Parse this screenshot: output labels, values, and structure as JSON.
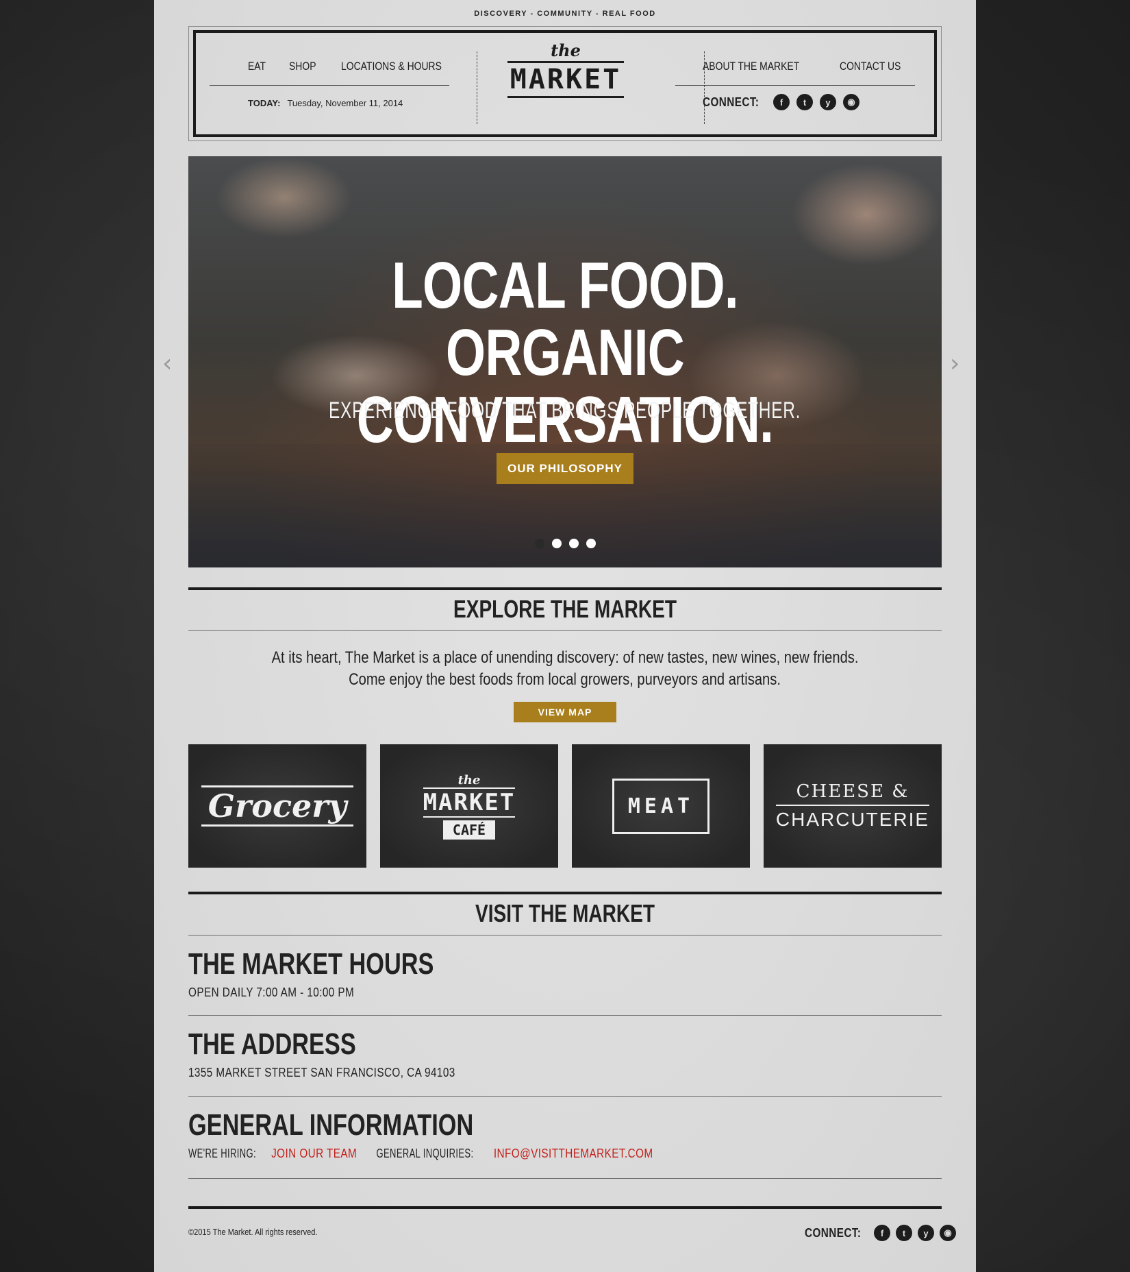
{
  "tagline": "DISCOVERY - COMMUNITY - REAL FOOD",
  "nav": {
    "left": [
      "EAT",
      "SHOP",
      "LOCATIONS & HOURS"
    ],
    "right": [
      "ABOUT THE MARKET",
      "CONTACT US"
    ]
  },
  "logo": {
    "the": "the",
    "word": "MARKET"
  },
  "today": {
    "label": "TODAY:",
    "date": "Tuesday, November 11, 2014"
  },
  "connect": {
    "label": "CONNECT:",
    "icons": [
      "facebook-icon",
      "twitter-icon",
      "yelp-icon",
      "instagram-icon"
    ],
    "glyphs": [
      "f",
      "t",
      "y",
      "◉"
    ]
  },
  "hero": {
    "title_line1": "LOCAL FOOD. ORGANIC",
    "title_line2": "CONVERSATION.",
    "subtitle": "EXPERIENCE FOOD THAT BRINGS PEOPLE TOGETHER.",
    "button": "OUR PHILOSOPHY",
    "slides": 4,
    "active_slide": 1,
    "prev_glyph": "‹",
    "next_glyph": "›"
  },
  "explore": {
    "title": "EXPLORE THE MARKET",
    "line1": "At its heart, The Market is a place of unending discovery: of new tastes, new wines, new friends.",
    "line2": "Come enjoy the best foods from local growers, purveyors and artisans.",
    "button": "VIEW MAP",
    "tiles": {
      "grocery": "Grocery",
      "cafe_the": "the",
      "cafe_market": "MARKET",
      "cafe_cafe": "CAFÉ",
      "meat": "MEAT",
      "cheese_line1": "CHEESE &",
      "cheese_line2": "CHARCUTERIE"
    }
  },
  "visit": {
    "title": "VISIT THE MARKET",
    "hours_title": "THE MARKET HOURS",
    "hours_text": "OPEN DAILY 7:00 AM - 10:00 PM",
    "address_title": "THE ADDRESS",
    "address_text": "1355 MARKET STREET SAN FRANCISCO, CA 94103",
    "general_title": "GENERAL INFORMATION",
    "hiring_label": "WE'RE HIRING:",
    "hiring_link": "JOIN OUR TEAM",
    "inquiries_label": "GENERAL INQUIRIES:",
    "inquiries_link": "INFO@VISITTHEMARKET.COM"
  },
  "footer": {
    "copyright": "©2015 The Market. All rights reserved.",
    "connect_label": "CONNECT:"
  },
  "colors": {
    "accent": "#a97e1c",
    "link_red": "#c2201a",
    "paper": "#dcdcdc",
    "chalkboard": "#2b2b2b"
  }
}
